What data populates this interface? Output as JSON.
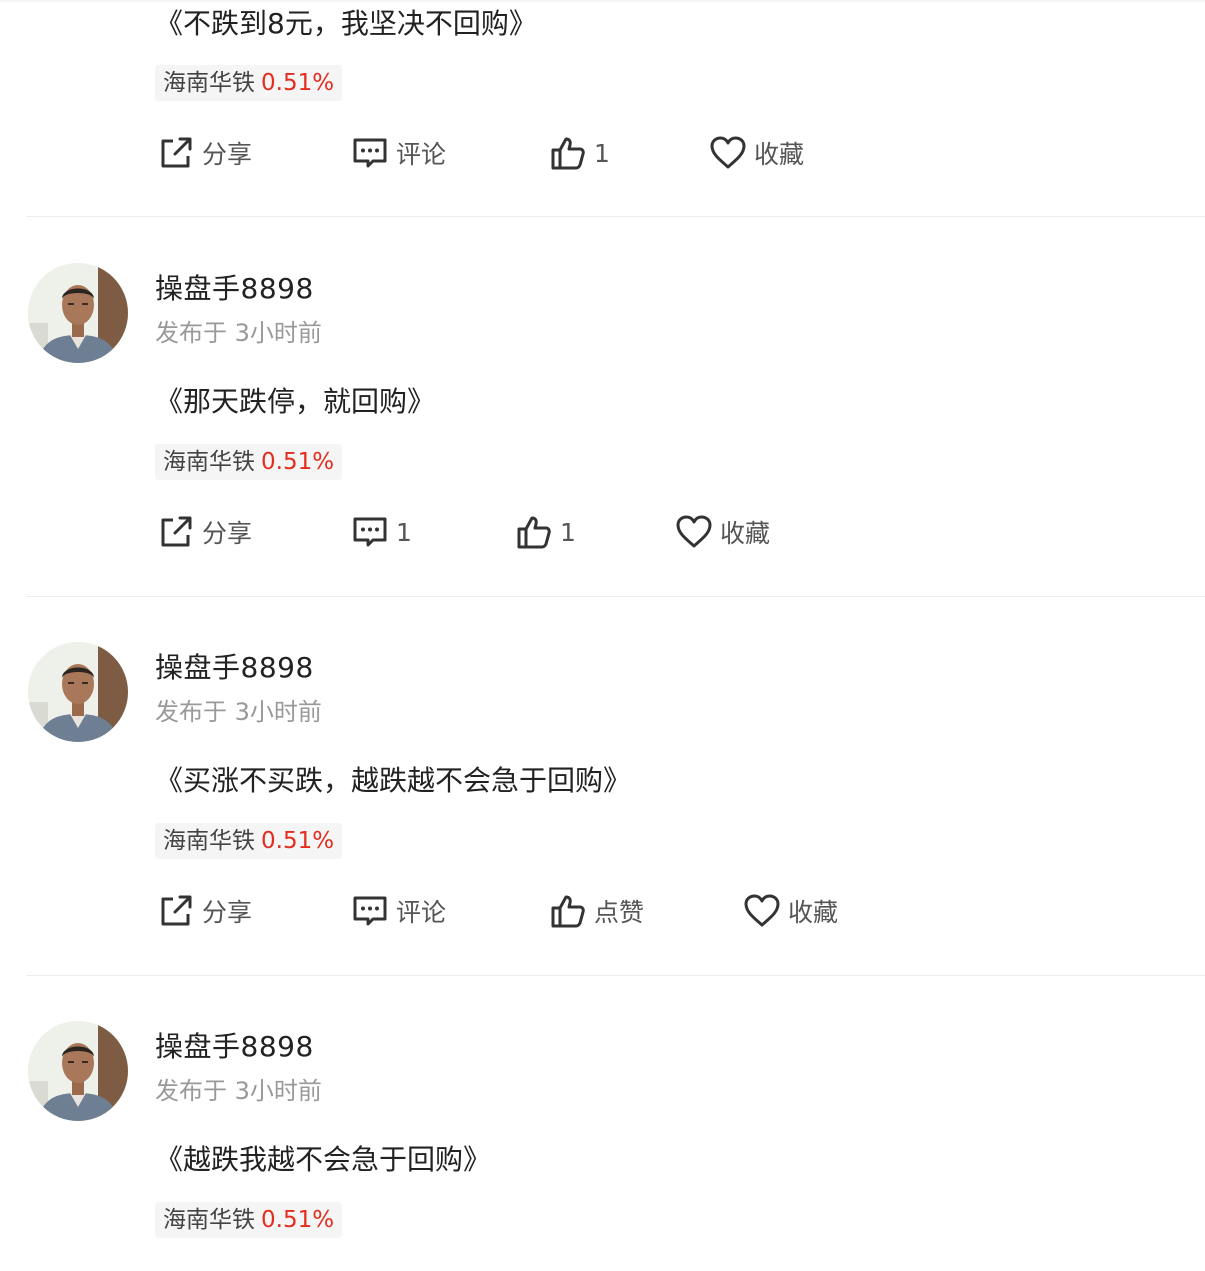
{
  "stock": {
    "name": "海南华铁",
    "change": "0.51%",
    "change_color": "#e32d1e"
  },
  "posts": [
    {
      "content": "《不跌到8元，我坚决不回购》",
      "actions": {
        "share": "分享",
        "comment": "评论",
        "like": "1",
        "favorite": "收藏"
      }
    },
    {
      "username": "操盘手8898",
      "time": "发布于 3小时前",
      "content": "《那天跌停，就回购》",
      "actions": {
        "share": "分享",
        "comment": "1",
        "like": "1",
        "favorite": "收藏"
      }
    },
    {
      "username": "操盘手8898",
      "time": "发布于 3小时前",
      "content": "《买涨不买跌，越跌越不会急于回购》",
      "actions": {
        "share": "分享",
        "comment": "评论",
        "like": "点赞",
        "favorite": "收藏"
      }
    },
    {
      "username": "操盘手8898",
      "time": "发布于 3小时前",
      "content": "《越跌我越不会急于回购》"
    }
  ],
  "icons": {
    "share": "share-icon",
    "comment": "comment-icon",
    "like": "thumbs-up-icon",
    "favorite": "heart-icon"
  }
}
